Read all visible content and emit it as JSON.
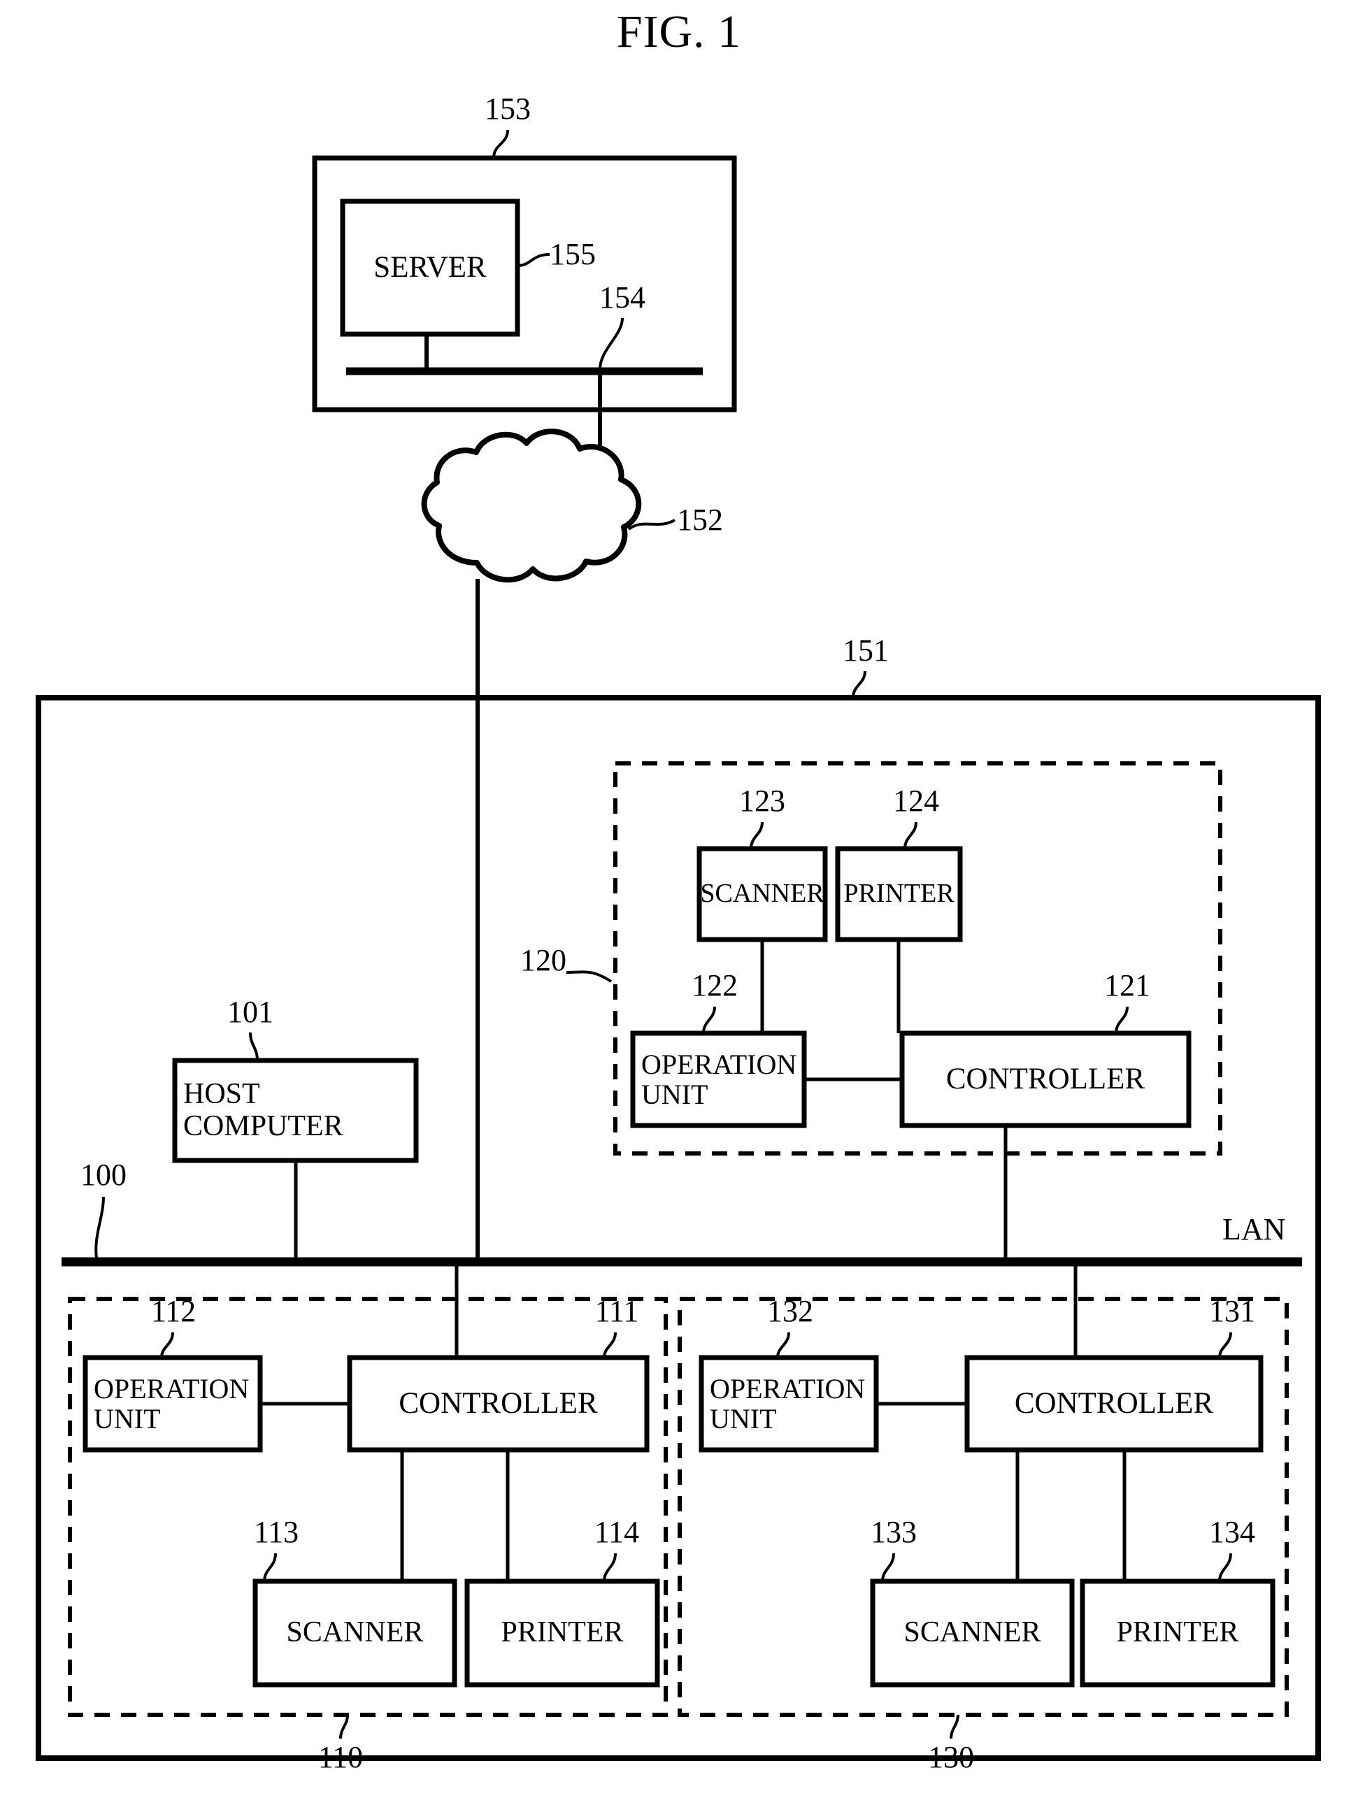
{
  "figure": {
    "title": "FIG. 1",
    "lan_label": "LAN"
  },
  "nodes": {
    "server": {
      "label": "SERVER",
      "ref": "155"
    },
    "server_enclosure": {
      "ref": "153"
    },
    "server_bus": {
      "ref": "154"
    },
    "cloud": {
      "ref": "152"
    },
    "outer_network": {
      "ref": "151"
    },
    "lan_bus": {
      "ref": "100"
    },
    "host_computer": {
      "label_line1": "HOST",
      "label_line2": "COMPUTER",
      "ref": "101"
    },
    "mfp120": {
      "ref": "120",
      "controller": {
        "label": "CONTROLLER",
        "ref": "121"
      },
      "operation_unit": {
        "label_line1": "OPERATION",
        "label_line2": "UNIT",
        "ref": "122"
      },
      "scanner": {
        "label": "SCANNER",
        "ref": "123"
      },
      "printer": {
        "label": "PRINTER",
        "ref": "124"
      }
    },
    "mfp110": {
      "ref": "110",
      "controller": {
        "label": "CONTROLLER",
        "ref": "111"
      },
      "operation_unit": {
        "label_line1": "OPERATION",
        "label_line2": "UNIT",
        "ref": "112"
      },
      "scanner": {
        "label": "SCANNER",
        "ref": "113"
      },
      "printer": {
        "label": "PRINTER",
        "ref": "114"
      }
    },
    "mfp130": {
      "ref": "130",
      "controller": {
        "label": "CONTROLLER",
        "ref": "131"
      },
      "operation_unit": {
        "label_line1": "OPERATION",
        "label_line2": "UNIT",
        "ref": "132"
      },
      "scanner": {
        "label": "SCANNER",
        "ref": "133"
      },
      "printer": {
        "label": "PRINTER",
        "ref": "134"
      }
    }
  },
  "colors": {
    "stroke": "#000000",
    "background": "#ffffff"
  }
}
